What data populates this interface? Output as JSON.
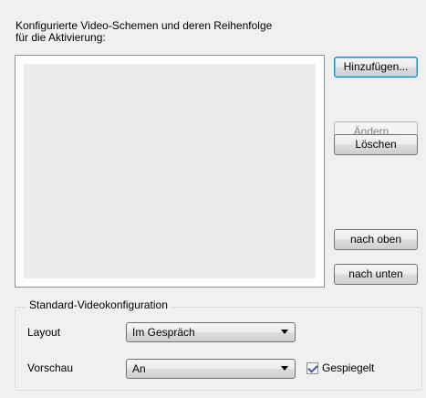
{
  "schemes": {
    "label_line1": "Konfigurierte Video-Schemen und deren Reihenfolge",
    "label_line2": "für die Aktivierung:"
  },
  "buttons": {
    "add": "Hinzufügen...",
    "change": "Ändern...",
    "delete": "Löschen",
    "up": "nach oben",
    "down": "nach unten"
  },
  "standard": {
    "title": "Standard-Videokonfiguration",
    "layout_label": "Layout",
    "layout_value": "Im Gespräch",
    "preview_label": "Vorschau",
    "preview_value": "An",
    "mirror_label": "Gespiegelt",
    "mirror_checked": true
  }
}
